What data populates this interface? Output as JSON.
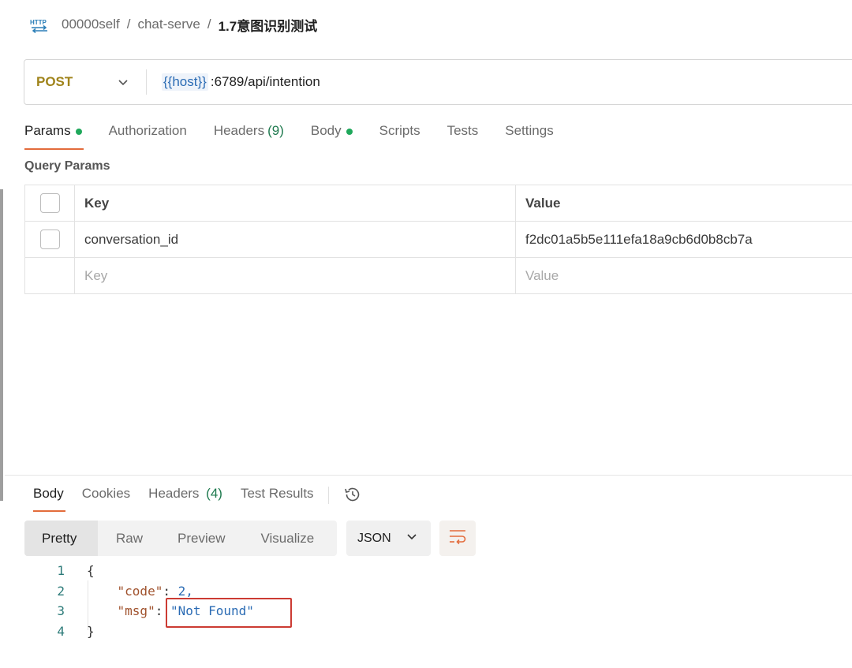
{
  "breadcrumb": {
    "icon": "http-icon",
    "items": [
      "00000self",
      "chat-serve"
    ],
    "separator": "/",
    "current": "1.7意图识别测试"
  },
  "request": {
    "method": "POST",
    "url_variable": "{{host}}",
    "url_rest": ":6789/api/intention"
  },
  "request_tabs": [
    {
      "label": "Params",
      "dot": true,
      "active": true
    },
    {
      "label": "Authorization"
    },
    {
      "label": "Headers",
      "count": "(9)"
    },
    {
      "label": "Body",
      "dot": true
    },
    {
      "label": "Scripts"
    },
    {
      "label": "Tests"
    },
    {
      "label": "Settings"
    }
  ],
  "query_params": {
    "title": "Query Params",
    "header_key": "Key",
    "header_value": "Value",
    "rows": [
      {
        "key": "conversation_id",
        "value": "f2dc01a5b5e111efa18a9cb6d0b8cb7a"
      }
    ],
    "placeholder_key": "Key",
    "placeholder_value": "Value"
  },
  "response_tabs": [
    {
      "label": "Body",
      "active": true
    },
    {
      "label": "Cookies"
    },
    {
      "label": "Headers",
      "count": "(4)"
    },
    {
      "label": "Test Results"
    }
  ],
  "view_options": [
    "Pretty",
    "Raw",
    "Preview",
    "Visualize"
  ],
  "format": "JSON",
  "code_lines": [
    {
      "num": "1",
      "text": "{"
    },
    {
      "num": "2",
      "key": "\"code\"",
      "value": "2,"
    },
    {
      "num": "3",
      "key": "\"msg\"",
      "value": "\"Not Found\""
    },
    {
      "num": "4",
      "text": "}"
    }
  ],
  "colors": {
    "method": "#a0841c",
    "active_tab_underline": "#e36c3c",
    "dot": "#1fa85b",
    "highlight_box": "#cc3b33"
  }
}
